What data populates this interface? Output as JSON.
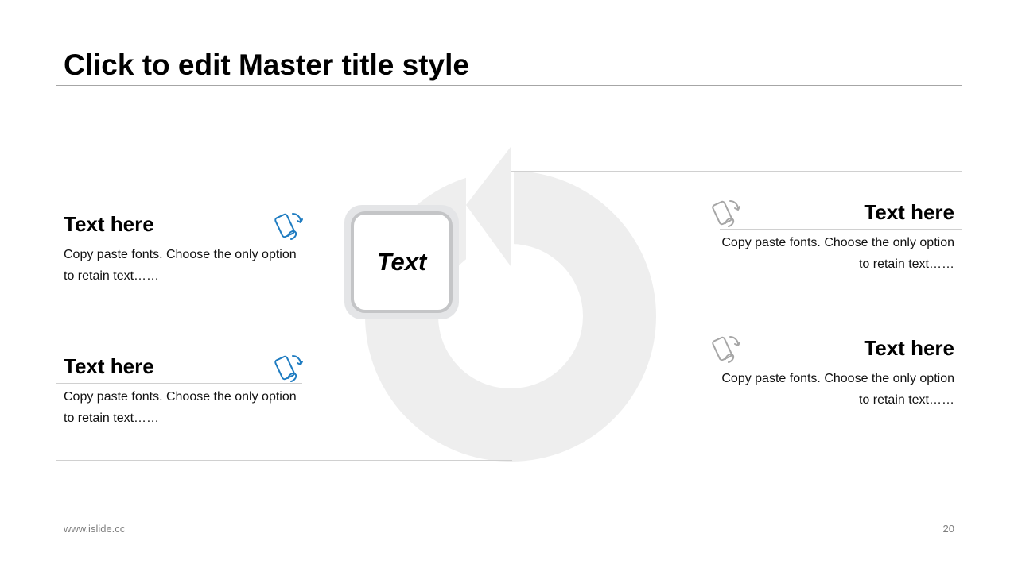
{
  "slide": {
    "title": "Click to edit Master title style",
    "center_label": "Text",
    "items": [
      {
        "title": "Text here",
        "desc": "Copy paste fonts. Choose the only option to retain text……",
        "icon": "phone-rotate-icon",
        "color": "#1f7cc1"
      },
      {
        "title": "Text here",
        "desc": "Copy paste fonts. Choose the only option to retain text……",
        "icon": "phone-rotate-icon",
        "color": "#1f7cc1"
      },
      {
        "title": "Text here",
        "desc": "Copy paste fonts. Choose the only option to retain text……",
        "icon": "phone-rotate-icon",
        "color": "#a6a6a6"
      },
      {
        "title": "Text here",
        "desc": "Copy paste fonts. Choose the only option to retain text……",
        "icon": "phone-rotate-icon",
        "color": "#a6a6a6"
      }
    ]
  },
  "footer": {
    "url": "www.islide.cc",
    "page": "20"
  },
  "colors": {
    "accent": "#1f7cc1",
    "muted": "#a6a6a6",
    "cycle": "#eeeeee"
  }
}
